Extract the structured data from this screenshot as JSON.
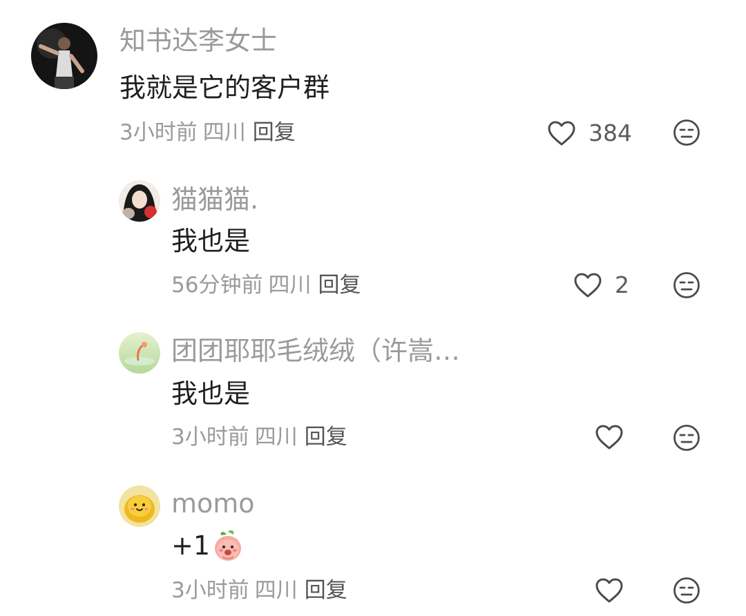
{
  "comments": [
    {
      "username": "知书达李女士",
      "text": "我就是它的客户群",
      "time": "3小时前",
      "location": "四川",
      "reply_label": "回复",
      "likes": "384"
    },
    {
      "username": "猫猫猫.",
      "text": "我也是",
      "time": "56分钟前",
      "location": "四川",
      "reply_label": "回复",
      "likes": "2"
    },
    {
      "username": "团团耶耶毛绒绒（许嵩…",
      "text": "我也是",
      "time": "3小时前",
      "location": "四川",
      "reply_label": "回复",
      "likes": ""
    },
    {
      "username": "momo",
      "text": "+1",
      "time": "3小时前",
      "location": "四川",
      "reply_label": "回复",
      "likes": ""
    }
  ],
  "icons": {
    "like": "heart-outline-icon",
    "dislike": "neutral-face-icon",
    "emoji": "peach-smile-emoji"
  },
  "colors": {
    "username": "#9a9a9a",
    "text": "#1f1f1f",
    "meta": "#9a9a9a",
    "reply": "#555555",
    "icon": "#4a4a4a"
  }
}
